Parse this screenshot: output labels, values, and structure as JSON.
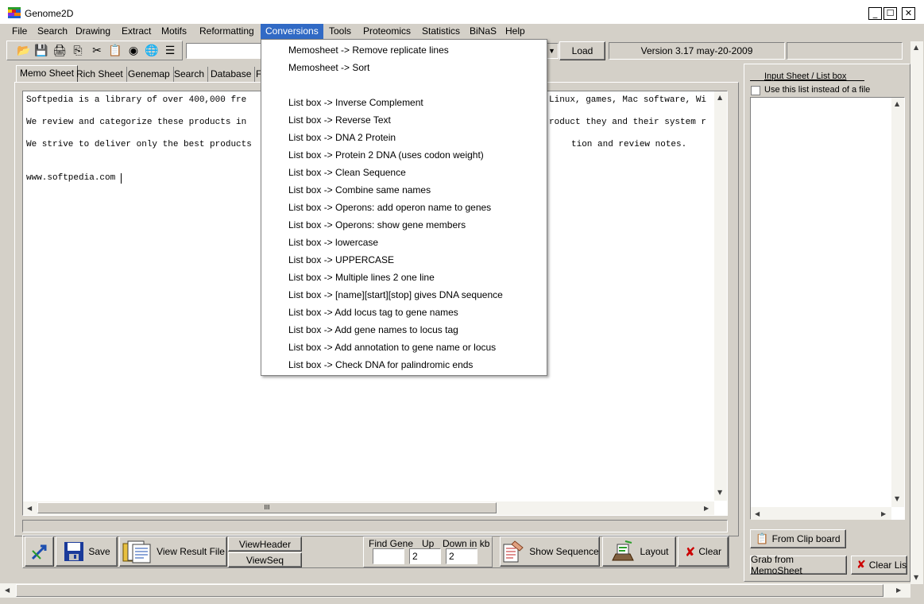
{
  "window": {
    "title": "Genome2D",
    "controls": {
      "minimize": "_",
      "maximize": "☐",
      "close": "✕"
    }
  },
  "menu": {
    "items": [
      "File",
      "Search",
      "Drawing",
      "Extract",
      "Motifs",
      "Reformatting",
      "Conversions",
      "Tools",
      "Proteomics",
      "Statistics",
      "BiNaS",
      "Help"
    ],
    "active": "Conversions"
  },
  "toolbar": {
    "icons": [
      "open-folder-icon",
      "save-disk-icon",
      "print-icon",
      "copy-icon",
      "cut-icon",
      "paste-icon",
      "eye-icon",
      "globe-icon",
      "list-icon"
    ],
    "combo_value": "",
    "load_label": "Load",
    "version_text": "Version 3.17   may-20-2009"
  },
  "tabs": [
    "Memo Sheet",
    "Rich Sheet",
    "Genemap",
    "Search",
    "Database",
    "F"
  ],
  "memo": {
    "lines": [
      "Softpedia is a library of over 400,000 fre",
      "We review and categorize these products in",
      "We strive to deliver only the best products",
      "",
      "www.softpedia.com"
    ],
    "right_fragments": [
      "Linux, games, Mac software, Wi",
      "roduct they and their system r",
      "tion and review notes."
    ]
  },
  "conversions_menu": {
    "items": [
      "Memosheet -> Remove replicate lines",
      "Memosheet -> Sort",
      "",
      "List box -> Inverse Complement",
      "List box -> Reverse Text",
      "List box -> DNA 2 Protein",
      "List box -> Protein 2 DNA (uses codon weight)",
      "List box -> Clean Sequence",
      "List box -> Combine same names",
      "List box -> Operons: add operon name to genes",
      "List box -> Operons: show gene members",
      "List box -> lowercase",
      "List box -> UPPERCASE",
      "List box -> Multiple lines 2 one line",
      "List box -> [name][start][stop] gives DNA sequence",
      "List box -> Add locus tag to gene names",
      "List box -> Add gene names to locus tag",
      "List box -> Add annotation to gene name or locus",
      "List box -> Check DNA for palindromic ends"
    ]
  },
  "right_panel": {
    "header": "Input Sheet / List box",
    "checkbox_label": "Use this list instead of a file",
    "checkbox_checked": false,
    "from_clipboard_label": "From Clip board",
    "grab_memosheet_label": "Grab from MemoSheet",
    "clear_list_label": "Clear List"
  },
  "bottom_bar": {
    "save_label": "Save",
    "view_result_label": "View Result File",
    "view_header_label": "ViewHeader",
    "view_seq_label": "ViewSeq",
    "find_gene_label": "Find Gene",
    "up_label": "Up",
    "down_label": "Down in kb",
    "find_gene_value": "",
    "up_value": "2",
    "down_value": "2",
    "show_sequence_label": "Show Sequence",
    "layout_label": "Layout",
    "clear_label": "Clear"
  },
  "scrollbar": {
    "grip": "III"
  },
  "colors": {
    "menu_highlight": "#316ac5",
    "face": "#d4d0c8",
    "clear_x": "#cc0000"
  }
}
